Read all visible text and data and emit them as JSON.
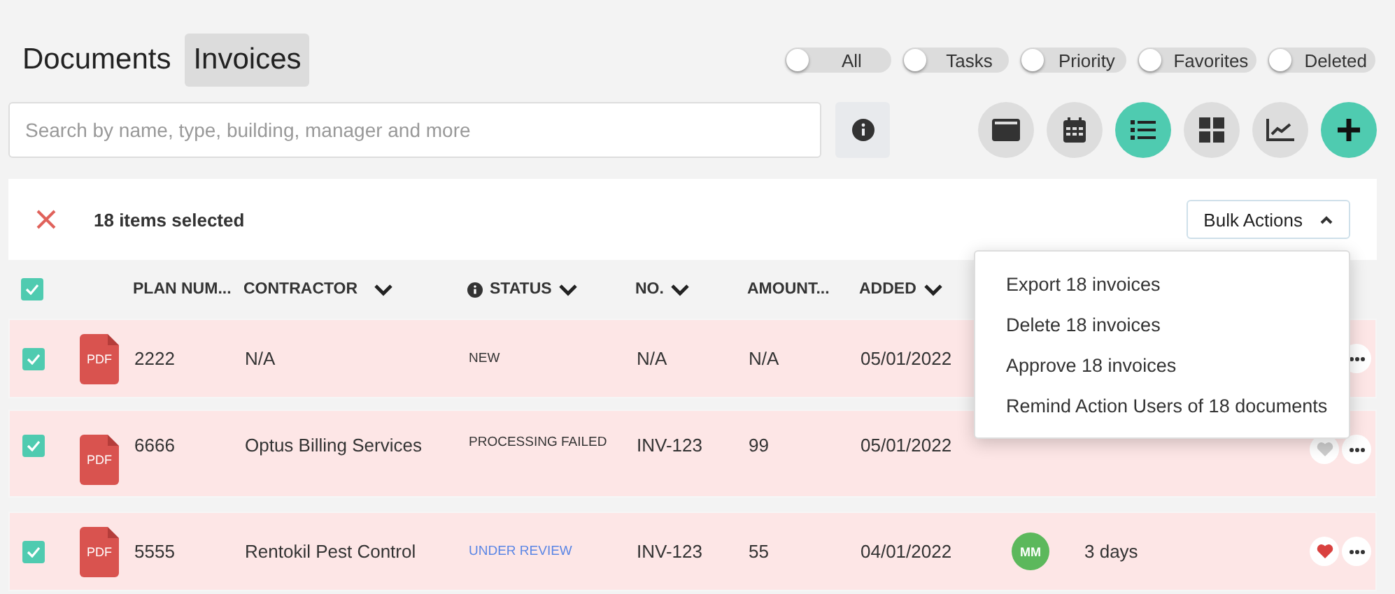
{
  "tabs": [
    {
      "label": "Documents",
      "selected": false
    },
    {
      "label": "Invoices",
      "selected": true
    }
  ],
  "filters": [
    {
      "label": "All",
      "on": false
    },
    {
      "label": "Tasks",
      "on": false
    },
    {
      "label": "Priority",
      "on": false
    },
    {
      "label": "Favorites",
      "on": false
    },
    {
      "label": "Deleted",
      "on": false
    }
  ],
  "search": {
    "placeholder": "Search by name, type, building, manager and more"
  },
  "views": [
    {
      "kind": "card",
      "selected": false
    },
    {
      "kind": "calendar",
      "selected": false
    },
    {
      "kind": "list",
      "selected": true
    },
    {
      "kind": "grid",
      "selected": false
    },
    {
      "kind": "chart",
      "selected": false
    },
    {
      "kind": "add",
      "selected": true
    }
  ],
  "selection": {
    "label": "18 items selected",
    "button": "Bulk Actions",
    "expanded": true,
    "menu": [
      "Export 18 invoices",
      "Delete 18 invoices",
      "Approve 18 invoices",
      "Remind Action Users of 18 documents"
    ]
  },
  "table": {
    "all_checked": true,
    "columns": [
      {
        "label": "PLAN NUM...",
        "kind": "plain"
      },
      {
        "label": "CONTRACTOR",
        "kind": "sortable"
      },
      {
        "label": "STATUS",
        "kind": "info_sortable"
      },
      {
        "label": "NO.",
        "kind": "sortable"
      },
      {
        "label": "AMOUNT...",
        "kind": "plain"
      },
      {
        "label": "ADDED",
        "kind": "sortable"
      }
    ],
    "rows": [
      {
        "checked": true,
        "file": "PDF",
        "plan": "2222",
        "contractor": "N/A",
        "status": {
          "text": "NEW",
          "color": "#333333"
        },
        "no": "N/A",
        "amount": "N/A",
        "added": "05/01/2022"
      },
      {
        "checked": true,
        "file": "PDF",
        "plan": "6666",
        "contractor": "Optus Billing Services",
        "status": {
          "text": "PROCESSING FAILED",
          "color": "#333333"
        },
        "no": "INV-123",
        "amount": "99",
        "added": "05/01/2022",
        "favorite": false
      },
      {
        "checked": true,
        "file": "PDF",
        "plan": "5555",
        "contractor": "Rentokil Pest Control",
        "status": {
          "text": "UNDER REVIEW",
          "color": "#5b86e5"
        },
        "no": "INV-123",
        "amount": "55",
        "added": "04/01/2022",
        "avatar": "MM",
        "age": "3 days",
        "favorite": true
      }
    ]
  }
}
